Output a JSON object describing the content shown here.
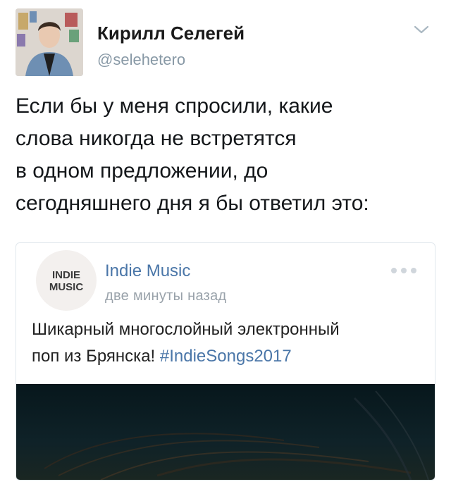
{
  "author": {
    "name": "Кирилл Селегей",
    "handle": "@selehetero",
    "avatar_icon": "profile-photo"
  },
  "tweet": {
    "text": "Если бы у меня спросили, какие\nслова никогда не встретятся\nв одном предложении, до\nсегодняшнего дня я бы ответил это:"
  },
  "card": {
    "logo_text": "INDIE MUSIC",
    "source_name": "Indie Music",
    "time": "две минуты назад",
    "text": "Шикарный многослойный электронный\nпоп из Брянска! ",
    "hashtag": "#IndieSongs2017"
  },
  "colors": {
    "link": "#4a76a8",
    "secondary_text": "#8899a6"
  }
}
